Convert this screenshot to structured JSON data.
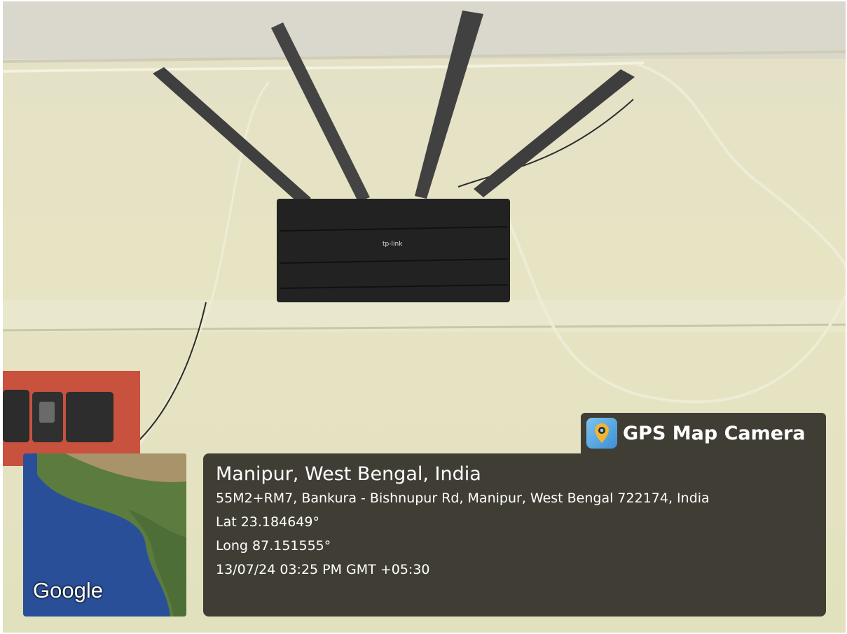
{
  "overlay": {
    "app_name": "GPS Map Camera",
    "app_icon": "camera-pin-icon",
    "location_title": "Manipur, West Bengal, India",
    "address": "55M2+RM7, Bankura - Bishnupur Rd, Manipur, West Bengal 722174, India",
    "latitude": "Lat 23.184649°",
    "longitude": "Long 87.151555°",
    "datetime": "13/07/24 03:25 PM GMT +05:30"
  },
  "map_thumbnail": {
    "attribution": "Google"
  },
  "device": {
    "brand_label": "tp-link"
  }
}
